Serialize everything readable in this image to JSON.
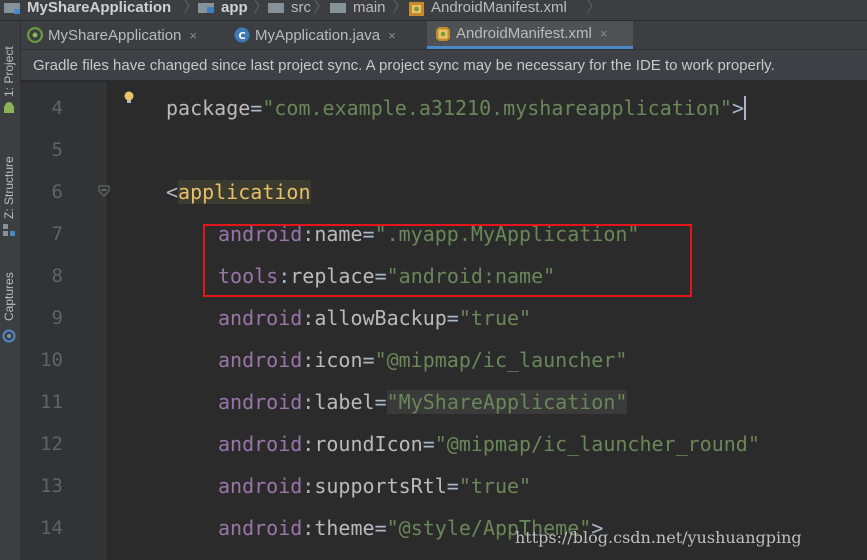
{
  "breadcrumbs": [
    "MyShareApplication",
    "app",
    "src",
    "main",
    "AndroidManifest.xml"
  ],
  "left_tools": [
    "1: Project",
    "Z: Structure",
    "Captures"
  ],
  "tabs": [
    {
      "label": "MyShareApplication",
      "close": "×"
    },
    {
      "label": "MyApplication.java",
      "close": "×"
    },
    {
      "label": "AndroidManifest.xml",
      "close": "×"
    }
  ],
  "banner": "Gradle files have changed since last project sync. A project sync may be necessary for the IDE to work properly.",
  "code": {
    "line_numbers": [
      "4",
      "5",
      "6",
      "7",
      "8",
      "9",
      "10",
      "11",
      "12",
      "13",
      "14"
    ],
    "l4": {
      "attr": "package",
      "eq": "=",
      "val": "\"com.example.a31210.myshareapplication\"",
      "end": ">"
    },
    "l6": {
      "open": "<",
      "tag": "application"
    },
    "l7": {
      "ns": "android",
      "colon": ":",
      "attr": "name",
      "eq": "=",
      "val": "\".myapp.MyApplication\""
    },
    "l8": {
      "ns": "tools",
      "colon": ":",
      "attr": "replace",
      "eq": "=",
      "val": "\"android:name\""
    },
    "l9": {
      "ns": "android",
      "colon": ":",
      "attr": "allowBackup",
      "eq": "=",
      "val": "\"true\""
    },
    "l10": {
      "ns": "android",
      "colon": ":",
      "attr": "icon",
      "eq": "=",
      "val": "\"@mipmap/ic_launcher\""
    },
    "l11": {
      "ns": "android",
      "colon": ":",
      "attr": "label",
      "eq": "=",
      "val": "\"MyShareApplication\""
    },
    "l12": {
      "ns": "android",
      "colon": ":",
      "attr": "roundIcon",
      "eq": "=",
      "val": "\"@mipmap/ic_launcher_round\""
    },
    "l13": {
      "ns": "android",
      "colon": ":",
      "attr": "supportsRtl",
      "eq": "=",
      "val": "\"true\""
    },
    "l14": {
      "ns": "android",
      "colon": ":",
      "attr": "theme",
      "eq": "=",
      "val": "\"@style/AppTheme\"",
      "end": ">"
    }
  },
  "watermark": "https://blog.csdn.net/yushuangping",
  "colors": {
    "highlight_box": "#e3161c",
    "active_tab_underline": "#4a88c7"
  }
}
